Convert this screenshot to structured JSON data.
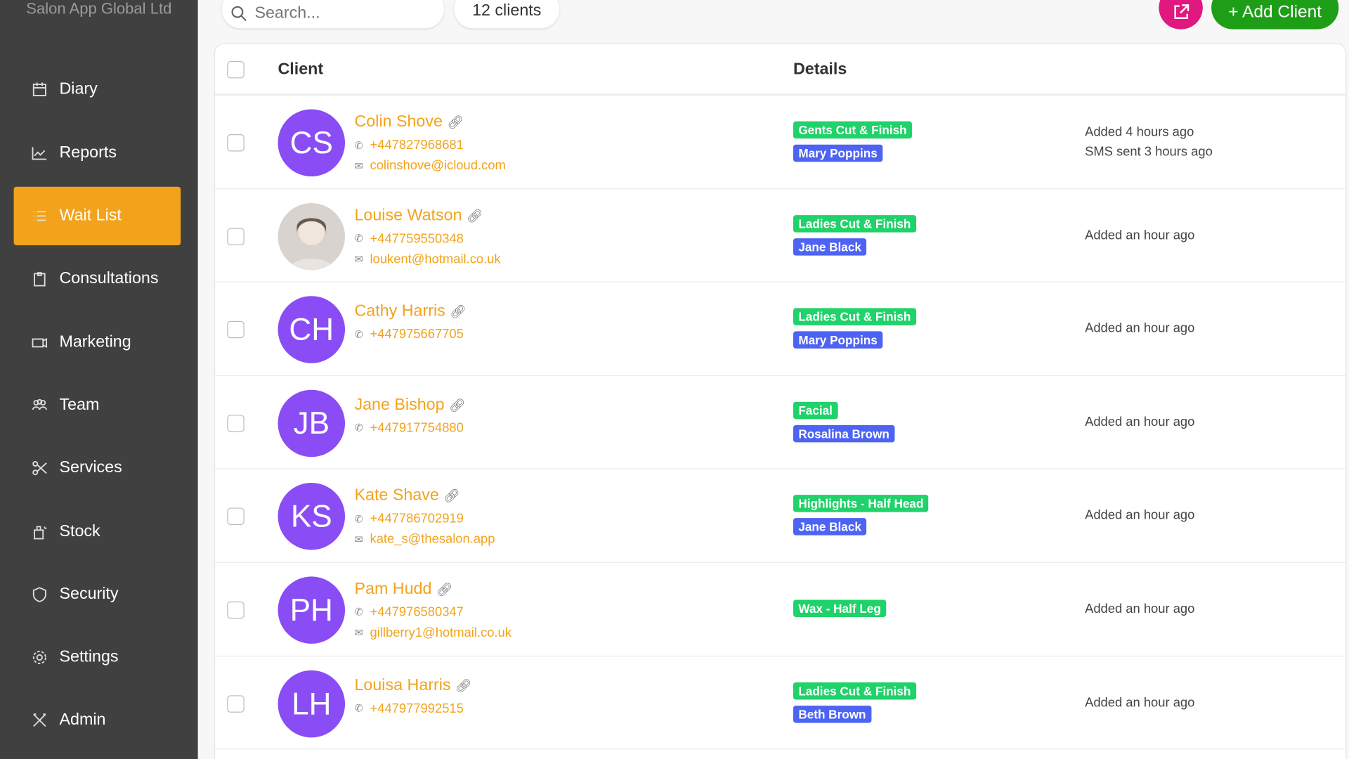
{
  "sidebar": {
    "org": "Salon App Global Ltd",
    "items": [
      {
        "label": "Diary",
        "icon": "calendar-icon"
      },
      {
        "label": "Reports",
        "icon": "chart-icon"
      },
      {
        "label": "Wait List",
        "icon": "list-icon",
        "active": true
      },
      {
        "label": "Consultations",
        "icon": "clipboard-icon"
      },
      {
        "label": "Marketing",
        "icon": "megaphone-icon"
      },
      {
        "label": "Team",
        "icon": "team-icon"
      },
      {
        "label": "Services",
        "icon": "scissors-icon"
      },
      {
        "label": "Stock",
        "icon": "stock-icon"
      },
      {
        "label": "Security",
        "icon": "shield-icon"
      },
      {
        "label": "Settings",
        "icon": "gear-icon"
      },
      {
        "label": "Admin",
        "icon": "tools-icon"
      }
    ]
  },
  "toolbar": {
    "search_placeholder": "Search...",
    "count": "12 clients",
    "add_label": "+ Add Client"
  },
  "table": {
    "headers": {
      "client": "Client",
      "details": "Details"
    },
    "rows": [
      {
        "initials": "CS",
        "name": "Colin Shove",
        "phone": "+447827968681",
        "email": "colinshove@icloud.com",
        "service": "Gents Cut & Finish",
        "staff": "Mary Poppins",
        "meta": [
          "Added 4 hours ago",
          "SMS sent 3 hours ago"
        ]
      },
      {
        "initials": "",
        "photo": true,
        "name": "Louise Watson",
        "phone": "+447759550348",
        "email": "loukent@hotmail.co.uk",
        "service": "Ladies Cut & Finish",
        "staff": "Jane Black",
        "meta": [
          "Added an hour ago"
        ]
      },
      {
        "initials": "CH",
        "name": "Cathy Harris",
        "phone": "+447975667705",
        "service": "Ladies Cut & Finish",
        "staff": "Mary Poppins",
        "meta": [
          "Added an hour ago"
        ]
      },
      {
        "initials": "JB",
        "name": "Jane Bishop",
        "phone": "+447917754880",
        "service": "Facial",
        "staff": "Rosalina Brown",
        "meta": [
          "Added an hour ago"
        ]
      },
      {
        "initials": "KS",
        "name": "Kate Shave",
        "phone": "+447786702919",
        "email": "kate_s@thesalon.app",
        "service": "Highlights - Half Head",
        "staff": "Jane Black",
        "meta": [
          "Added an hour ago"
        ]
      },
      {
        "initials": "PH",
        "name": "Pam Hudd",
        "phone": "+447976580347",
        "email": "gillberry1@hotmail.co.uk",
        "service": "Wax - Half Leg",
        "meta": [
          "Added an hour ago"
        ]
      },
      {
        "initials": "LH",
        "name": "Louisa Harris",
        "phone": "+447977992515",
        "service": "Ladies Cut & Finish",
        "staff": "Beth Brown",
        "meta": [
          "Added an hour ago"
        ]
      }
    ]
  },
  "colors": {
    "accent": "#f2a31b",
    "avatar": "#8a4cf5",
    "service_tag": "#20d26a",
    "staff_tag": "#4d63f3",
    "share": "#e0187f",
    "add": "#1e9e16"
  }
}
